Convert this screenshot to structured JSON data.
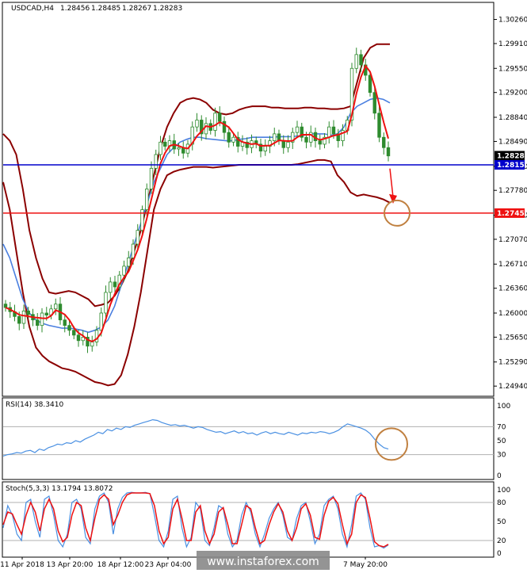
{
  "chart_data": [
    {
      "type": "line",
      "name": "main",
      "title": "USDCAD,H4",
      "ohlc_header": [
        "1.28456",
        "1.28485",
        "1.28267",
        "1.28283"
      ],
      "ylim": [
        1.2485,
        1.3045
      ],
      "y_ticks": [
        "1.30260",
        "1.29910",
        "1.29550",
        "1.29200",
        "1.28840",
        "1.28490",
        "1.28130",
        "1.27780",
        "1.27420",
        "1.27070",
        "1.26710",
        "1.26360",
        "1.26000",
        "1.25650",
        "1.25290",
        "1.24940"
      ],
      "price_tags": [
        {
          "label": "1.28283",
          "value": 1.28283,
          "color": "#000000"
        },
        {
          "label": "1.28150",
          "value": 1.2815,
          "color": "#0000cc"
        },
        {
          "label": "1.27450",
          "value": 1.2745,
          "color": "#ee1111"
        }
      ],
      "hlines": [
        {
          "value": 1.2815,
          "color": "#0000cc"
        },
        {
          "value": 1.2745,
          "color": "#ee1111"
        }
      ],
      "close_series": [
        1.2608,
        1.2602,
        1.2595,
        1.2585,
        1.2603,
        1.2598,
        1.259,
        1.2582,
        1.26,
        1.2597,
        1.2606,
        1.2613,
        1.259,
        1.2582,
        1.2575,
        1.2568,
        1.256,
        1.2565,
        1.2552,
        1.2558,
        1.2575,
        1.26,
        1.263,
        1.2645,
        1.2638,
        1.2655,
        1.2668,
        1.268,
        1.27,
        1.272,
        1.275,
        1.278,
        1.281,
        1.283,
        1.2848,
        1.2842,
        1.285,
        1.2838,
        1.284,
        1.2832,
        1.2845,
        1.287,
        1.288,
        1.286,
        1.2875,
        1.2865,
        1.289,
        1.2878,
        1.2862,
        1.2848,
        1.2855,
        1.2842,
        1.2848,
        1.284,
        1.285,
        1.2845,
        1.2835,
        1.2842,
        1.285,
        1.286,
        1.285,
        1.284,
        1.2848,
        1.2862,
        1.287,
        1.2855,
        1.2848,
        1.2862,
        1.285,
        1.2845,
        1.2855,
        1.287,
        1.286,
        1.285,
        1.2865,
        1.288,
        1.2955,
        1.2975,
        1.296,
        1.2945,
        1.292,
        1.289,
        1.2855,
        1.284,
        1.2828
      ],
      "bb_upper": [
        1.286,
        1.285,
        1.283,
        1.278,
        1.272,
        1.268,
        1.265,
        1.263,
        1.2628,
        1.263,
        1.2632,
        1.263,
        1.2625,
        1.262,
        1.261,
        1.2612,
        1.2615,
        1.2625,
        1.264,
        1.266,
        1.269,
        1.272,
        1.276,
        1.28,
        1.284,
        1.287,
        1.289,
        1.2905,
        1.291,
        1.2912,
        1.291,
        1.2905,
        1.2895,
        1.289,
        1.2888,
        1.289,
        1.2895,
        1.2898,
        1.29,
        1.29,
        1.29,
        1.2898,
        1.2898,
        1.2897,
        1.2897,
        1.2897,
        1.2898,
        1.2898,
        1.2897,
        1.2897,
        1.2896,
        1.2896,
        1.2897,
        1.29,
        1.2935,
        1.297,
        1.2985,
        1.299,
        1.299,
        1.299
      ],
      "bb_lower": [
        1.279,
        1.275,
        1.269,
        1.263,
        1.258,
        1.255,
        1.2538,
        1.253,
        1.2525,
        1.252,
        1.2518,
        1.2515,
        1.251,
        1.2505,
        1.25,
        1.2498,
        1.2495,
        1.2497,
        1.251,
        1.254,
        1.258,
        1.263,
        1.269,
        1.275,
        1.278,
        1.28,
        1.2805,
        1.2808,
        1.281,
        1.2812,
        1.2812,
        1.2812,
        1.2811,
        1.2812,
        1.2813,
        1.2814,
        1.2815,
        1.2815,
        1.2815,
        1.2815,
        1.2815,
        1.2815,
        1.2815,
        1.2815,
        1.2815,
        1.2816,
        1.2818,
        1.282,
        1.2822,
        1.2822,
        1.282,
        1.28,
        1.279,
        1.2775,
        1.277,
        1.2772,
        1.277,
        1.2768,
        1.2765,
        1.276
      ],
      "bb_middle": [
        1.27,
        1.268,
        1.265,
        1.262,
        1.26,
        1.259,
        1.2585,
        1.2582,
        1.258,
        1.2578,
        1.2578,
        1.2577,
        1.2575,
        1.2572,
        1.2575,
        1.258,
        1.259,
        1.261,
        1.264,
        1.267,
        1.27,
        1.273,
        1.276,
        1.279,
        1.281,
        1.283,
        1.284,
        1.2848,
        1.2852,
        1.2855,
        1.2855,
        1.2853,
        1.2852,
        1.2851,
        1.285,
        1.285,
        1.2852,
        1.2853,
        1.2855,
        1.2855,
        1.2855,
        1.2855,
        1.2856,
        1.2856,
        1.2856,
        1.2857,
        1.2858,
        1.286,
        1.286,
        1.286,
        1.2858,
        1.286,
        1.287,
        1.289,
        1.29,
        1.2905,
        1.291,
        1.2912,
        1.291,
        1.2905
      ]
    },
    {
      "type": "line",
      "name": "rsi",
      "title": "RSI(14) 38.3410",
      "ylim": [
        0,
        100
      ],
      "y_ticks": [
        "100",
        "70",
        "50",
        "30",
        "0"
      ],
      "levels": [
        70,
        30
      ],
      "values": [
        28,
        30,
        31,
        33,
        32,
        35,
        36,
        33,
        38,
        36,
        40,
        42,
        45,
        44,
        47,
        46,
        50,
        48,
        52,
        55,
        58,
        62,
        60,
        66,
        64,
        68,
        66,
        70,
        69,
        72,
        74,
        76,
        78,
        80,
        79,
        76,
        74,
        72,
        73,
        71,
        72,
        70,
        68,
        70,
        69,
        66,
        64,
        62,
        63,
        60,
        62,
        64,
        61,
        63,
        60,
        61,
        58,
        61,
        63,
        60,
        62,
        60,
        59,
        62,
        60,
        58,
        61,
        60,
        62,
        61,
        63,
        62,
        60,
        62,
        65,
        70,
        74,
        72,
        70,
        68,
        65,
        60,
        52,
        45,
        40,
        38
      ]
    },
    {
      "type": "line",
      "name": "stochastic",
      "title": "Stoch(5,3,3) 13.1794 13.8072",
      "ylim": [
        0,
        100
      ],
      "y_ticks": [
        "100",
        "80",
        "50",
        "20",
        "0"
      ],
      "levels": [
        80,
        20
      ],
      "main": [
        40,
        75,
        60,
        30,
        20,
        80,
        85,
        50,
        25,
        85,
        90,
        60,
        20,
        10,
        30,
        80,
        85,
        70,
        25,
        15,
        70,
        90,
        95,
        80,
        30,
        70,
        88,
        95,
        96,
        95,
        95,
        96,
        94,
        60,
        20,
        10,
        35,
        85,
        90,
        40,
        10,
        25,
        80,
        70,
        20,
        12,
        40,
        75,
        70,
        30,
        10,
        20,
        60,
        80,
        65,
        30,
        10,
        30,
        55,
        70,
        80,
        60,
        25,
        20,
        55,
        75,
        80,
        50,
        15,
        30,
        75,
        85,
        90,
        70,
        30,
        10,
        45,
        90,
        95,
        85,
        40,
        10,
        12,
        8,
        13
      ],
      "signal": [
        45,
        65,
        62,
        45,
        30,
        60,
        80,
        65,
        35,
        70,
        85,
        70,
        35,
        18,
        25,
        60,
        80,
        75,
        40,
        20,
        55,
        85,
        92,
        85,
        45,
        60,
        80,
        92,
        95,
        95,
        95,
        95,
        94,
        75,
        35,
        15,
        25,
        70,
        85,
        55,
        20,
        20,
        65,
        75,
        35,
        15,
        30,
        65,
        72,
        45,
        15,
        15,
        45,
        75,
        70,
        40,
        15,
        20,
        45,
        65,
        78,
        65,
        35,
        20,
        40,
        70,
        78,
        60,
        25,
        22,
        60,
        82,
        88,
        78,
        45,
        15,
        30,
        80,
        92,
        88,
        55,
        18,
        12,
        10,
        14
      ]
    }
  ],
  "x_axis_labels": [
    "11 Apr 2018",
    "13 Apr 20:00",
    "18 Apr 12:00",
    "23 Apr 04:00",
    "7 May 20:00"
  ],
  "watermark": "www.instaforex.com",
  "colors": {
    "candle": "#2e8b2e",
    "bb": "#8b0000",
    "ma_fast": "#ee1111",
    "ma_slow": "#4a7fe0",
    "support": "#0000cc",
    "resistance": "#ee1111",
    "circle": "#c08040",
    "rsi": "#4a90e2",
    "stoch_main": "#4a90e2",
    "stoch_signal": "#ee1111"
  }
}
